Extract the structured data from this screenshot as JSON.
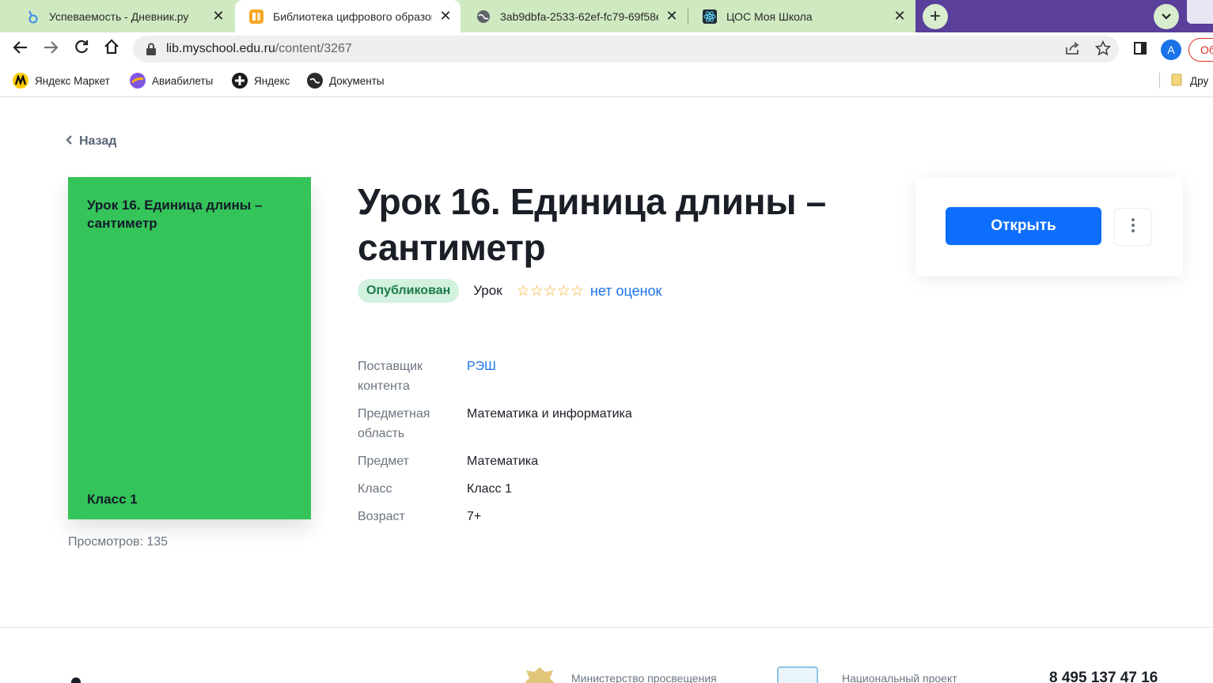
{
  "browser": {
    "tabs": [
      {
        "title": "Успеваемость - Дневник.ру",
        "icon": "dnevnik-icon",
        "active": false
      },
      {
        "title": "Библиотека цифрового образов",
        "icon": "library-icon",
        "active": true
      },
      {
        "title": "3ab9dbfa-2533-62ef-fc79-69f58e",
        "icon": "globe-icon",
        "active": false
      },
      {
        "title": "ЦОС Моя Школа",
        "icon": "react-icon",
        "active": false
      }
    ],
    "close_glyph": "✕",
    "new_tab_glyph": "+",
    "url_host": "lib.myschool.edu.ru",
    "url_path": "/content/3267",
    "profile_initial": "A",
    "update_label": "Об",
    "bookmarks": [
      {
        "label": "Яндекс Маркет",
        "icon": "yandex-market-icon"
      },
      {
        "label": "Авиабилеты",
        "icon": "planet-icon"
      },
      {
        "label": "Яндекс",
        "icon": "yandex-icon"
      },
      {
        "label": "Документы",
        "icon": "globe-icon"
      }
    ],
    "other_bookmarks": "Дру"
  },
  "page": {
    "back_label": "Назад",
    "cover": {
      "title": "Урок 16. Единица длины – сантиметр",
      "grade": "Класс 1",
      "color": "#34c459"
    },
    "views": "Просмотров: 135",
    "title": "Урок 16. Единица длины – сантиметр",
    "status": "Опубликован",
    "type": "Урок",
    "rating": {
      "stars_total": 5,
      "stars_filled": 0,
      "text": "нет оценок"
    },
    "info": [
      {
        "label": "Поставщик контента",
        "value": "РЭШ",
        "link": true
      },
      {
        "label": "Предметная область",
        "value": "Математика и информатика",
        "link": false
      },
      {
        "label": "Предмет",
        "value": "Математика",
        "link": false
      },
      {
        "label": "Класс",
        "value": "Класс 1",
        "link": false
      },
      {
        "label": "Возраст",
        "value": "7+",
        "link": false
      }
    ],
    "open_button": "Открыть",
    "footer": {
      "ministry": "Министерство просвещения",
      "national_project": "Национальный проект",
      "phone": "8 495 137 47 16"
    }
  },
  "colors": {
    "accent": "#0d6efd",
    "link": "#1a73e8",
    "badge_bg": "#d2f1df",
    "badge_text": "#1d7a48",
    "star": "#f2b12b"
  }
}
